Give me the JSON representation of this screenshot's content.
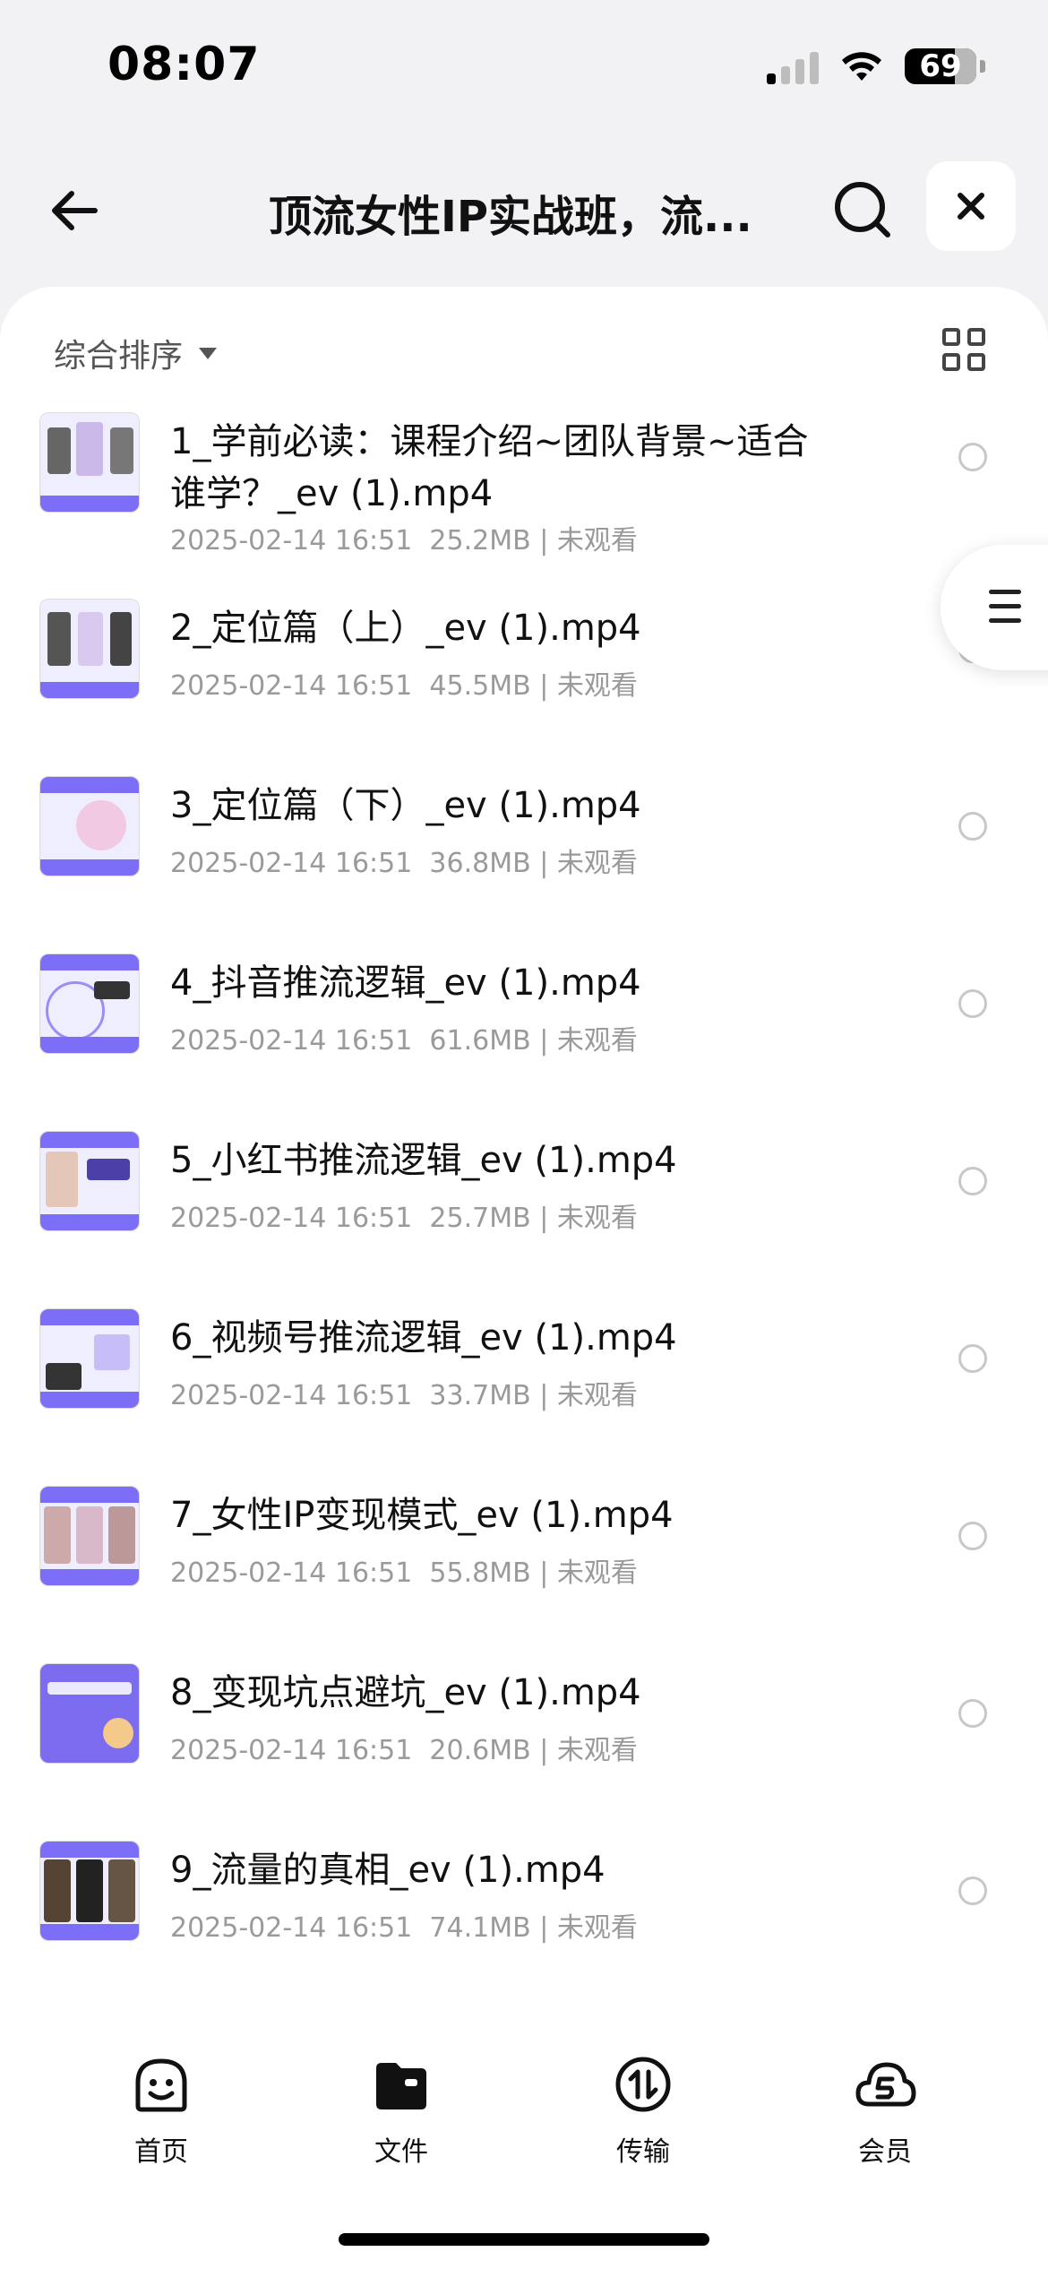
{
  "status": {
    "time": "08:07",
    "battery": "69"
  },
  "nav": {
    "title": "顶流女性IP实战班，流..."
  },
  "sort": {
    "label": "综合排序"
  },
  "files": [
    {
      "name": "1_学前必读：课程介绍~团队背景~适合谁学？_ev (1).mp4",
      "date": "2025-02-14 16:51",
      "size": "25.2MB",
      "status": "未观看"
    },
    {
      "name": "2_定位篇（上）_ev (1).mp4",
      "date": "2025-02-14 16:51",
      "size": "45.5MB",
      "status": "未观看"
    },
    {
      "name": "3_定位篇（下）_ev (1).mp4",
      "date": "2025-02-14 16:51",
      "size": "36.8MB",
      "status": "未观看"
    },
    {
      "name": "4_抖音推流逻辑_ev (1).mp4",
      "date": "2025-02-14 16:51",
      "size": "61.6MB",
      "status": "未观看"
    },
    {
      "name": "5_小红书推流逻辑_ev (1).mp4",
      "date": "2025-02-14 16:51",
      "size": "25.7MB",
      "status": "未观看"
    },
    {
      "name": "6_视频号推流逻辑_ev (1).mp4",
      "date": "2025-02-14 16:51",
      "size": "33.7MB",
      "status": "未观看"
    },
    {
      "name": "7_女性IP变现模式_ev (1).mp4",
      "date": "2025-02-14 16:51",
      "size": "55.8MB",
      "status": "未观看"
    },
    {
      "name": "8_变现坑点避坑_ev (1).mp4",
      "date": "2025-02-14 16:51",
      "size": "20.6MB",
      "status": "未观看"
    },
    {
      "name": "9_流量的真相_ev (1).mp4",
      "date": "2025-02-14 16:51",
      "size": "74.1MB",
      "status": "未观看"
    }
  ],
  "tabs": [
    {
      "label": "首页",
      "icon": "smile-face-icon"
    },
    {
      "label": "文件",
      "icon": "folder-icon"
    },
    {
      "label": "传输",
      "icon": "transfer-icon"
    },
    {
      "label": "会员",
      "icon": "cloud-member-icon"
    }
  ]
}
